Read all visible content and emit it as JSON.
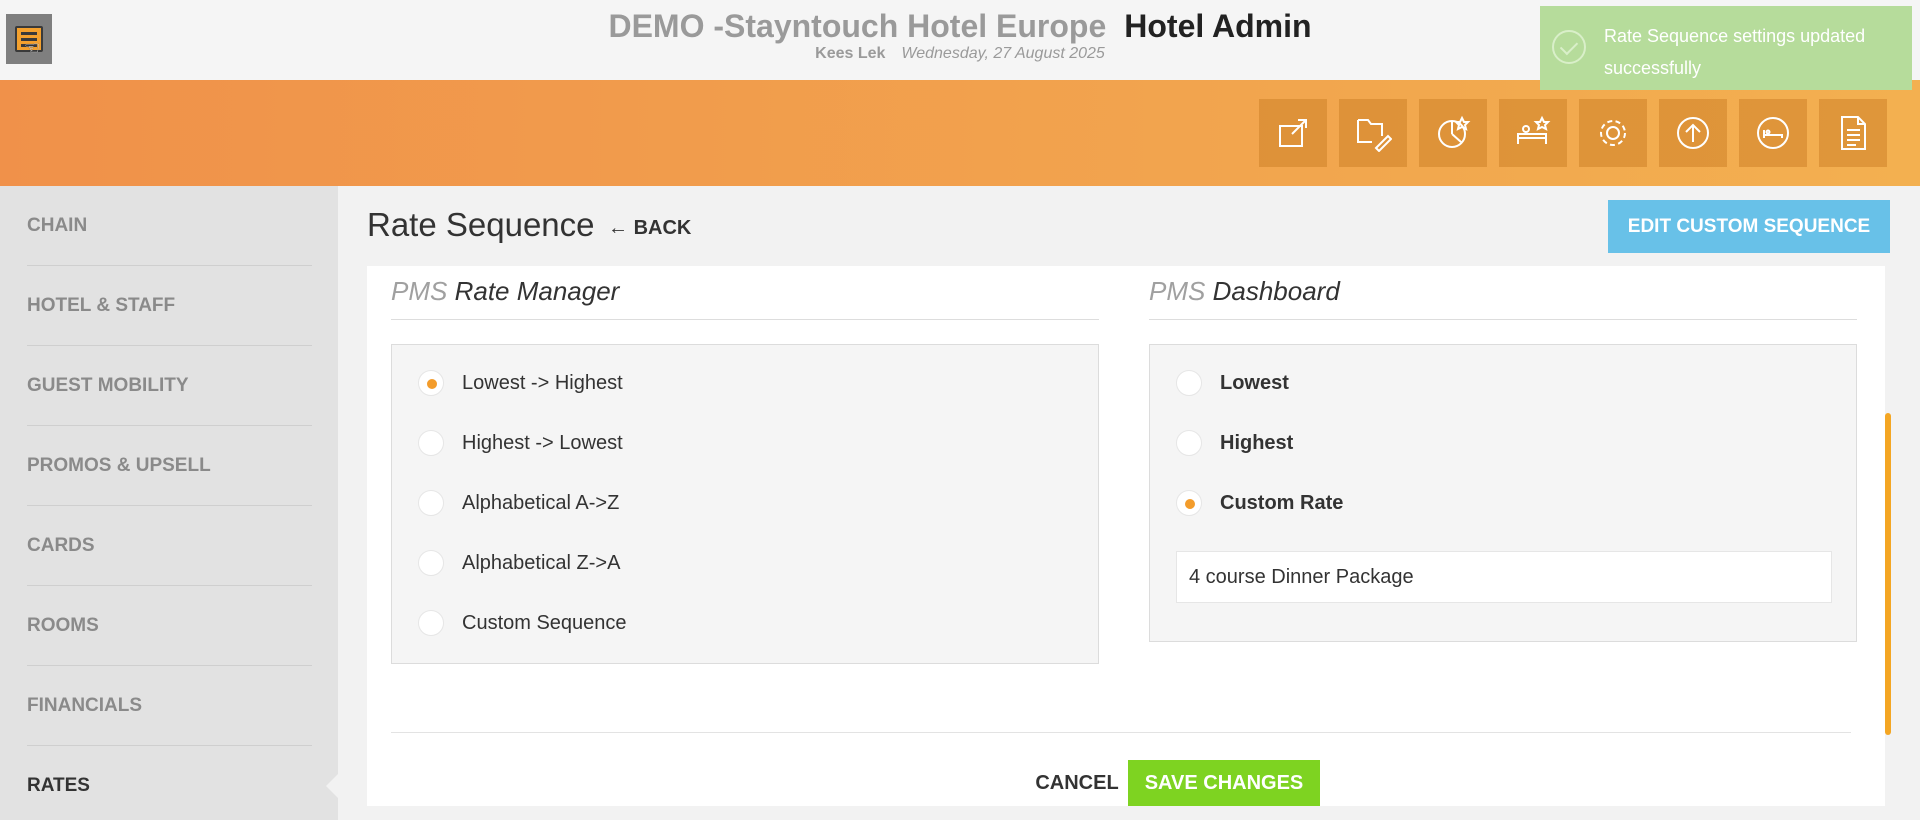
{
  "header": {
    "hotel_name": "DEMO -Stayntouch Hotel Europe",
    "app_name": "Hotel Admin",
    "user_name": "Kees Lek",
    "date": "Wednesday, 27 August 2025"
  },
  "toolbar": {
    "icons": [
      "external-link-icon",
      "folder-edit-icon",
      "rate-chart-icon",
      "staff-star-icon",
      "gear-icon",
      "upload-circle-icon",
      "room-bed-icon",
      "document-icon"
    ]
  },
  "toast": {
    "message": "Rate Sequence settings updated successfully"
  },
  "sidebar": {
    "items": [
      {
        "label": "CHAIN"
      },
      {
        "label": "HOTEL & STAFF"
      },
      {
        "label": "GUEST MOBILITY"
      },
      {
        "label": "PROMOS & UPSELL"
      },
      {
        "label": "CARDS"
      },
      {
        "label": "ROOMS"
      },
      {
        "label": "FINANCIALS"
      },
      {
        "label": "RATES"
      }
    ],
    "active": "RATES"
  },
  "main": {
    "title": "Rate Sequence",
    "back_label": "BACK",
    "edit_button": "EDIT CUSTOM SEQUENCE",
    "rate_manager": {
      "prefix": "PMS",
      "name": "Rate Manager",
      "options": [
        "Lowest -> Highest",
        "Highest -> Lowest",
        "Alphabetical A->Z",
        "Alphabetical Z->A",
        "Custom Sequence"
      ],
      "selected": "Lowest -> Highest"
    },
    "dashboard": {
      "prefix": "PMS",
      "name": "Dashboard",
      "options": [
        "Lowest",
        "Highest",
        "Custom Rate"
      ],
      "selected": "Custom Rate",
      "custom_rate_value": "4 course Dinner Package"
    },
    "cancel_label": "CANCEL",
    "save_label": "SAVE CHANGES"
  },
  "colors": {
    "accent_orange": "#f39c2b",
    "edit_button_blue": "#68c1e8",
    "save_button_green": "#7ed321",
    "toast_green": "#b6dc9b"
  }
}
